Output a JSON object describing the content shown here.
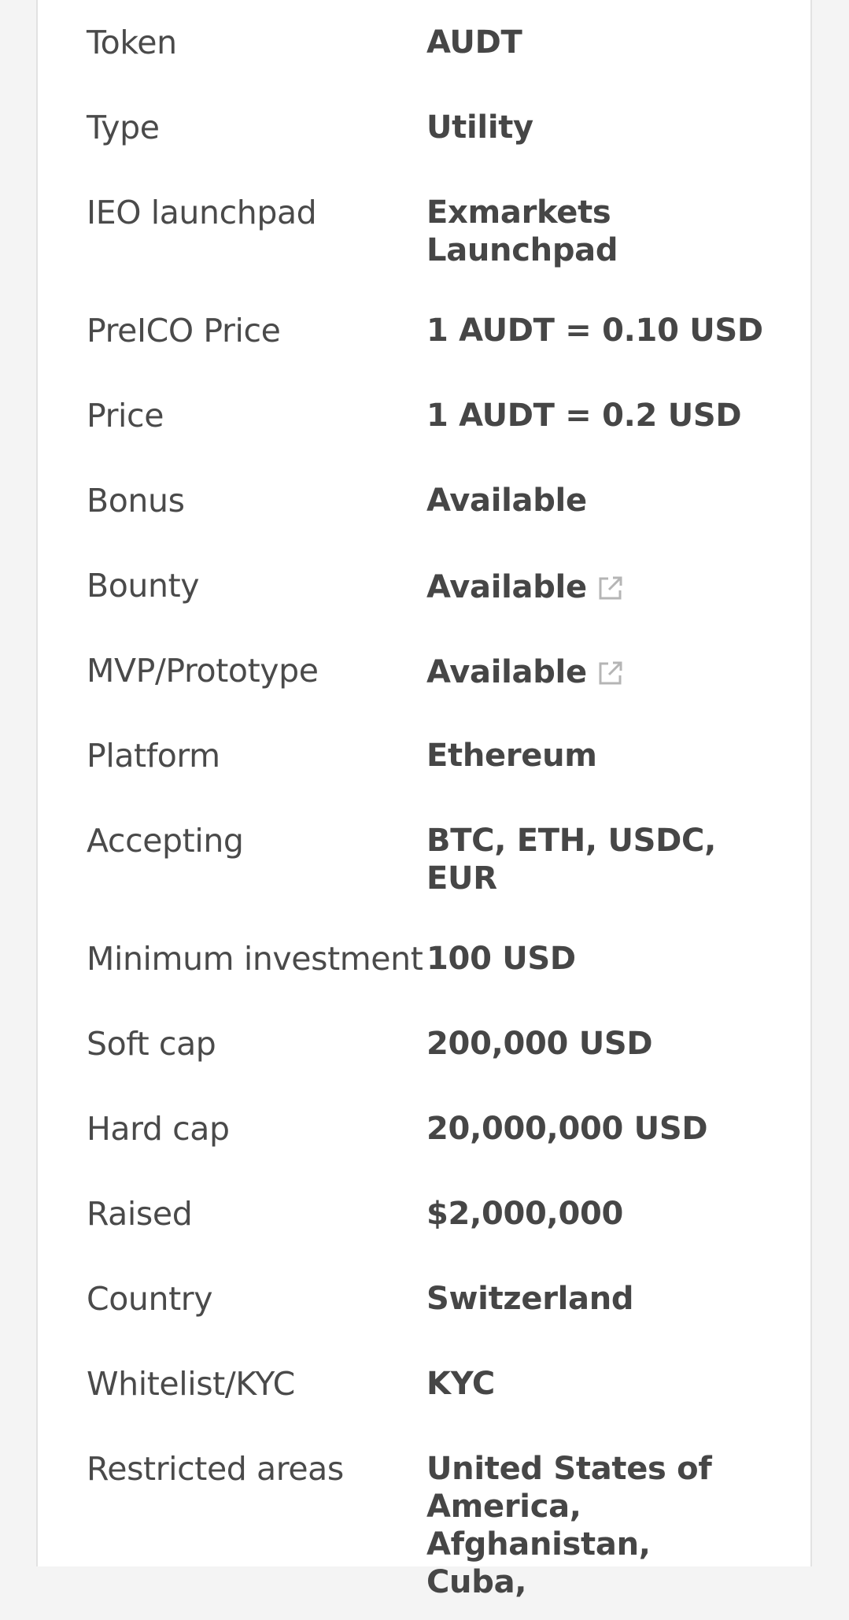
{
  "rows": [
    {
      "label": "Token",
      "value": "AUDT"
    },
    {
      "label": "Type",
      "value": "Utility"
    },
    {
      "label": "IEO launchpad",
      "value": "Exmarkets Launchpad"
    },
    {
      "label": "PreICO Price",
      "value": "1 AUDT = 0.10 USD"
    },
    {
      "label": "Price",
      "value": "1 AUDT = 0.2 USD"
    },
    {
      "label": "Bonus",
      "value": "Available"
    },
    {
      "label": "Bounty",
      "value": "Available",
      "icon": "external-link-icon"
    },
    {
      "label": "MVP/Prototype",
      "value": "Available",
      "icon": "external-link-icon"
    },
    {
      "label": "Platform",
      "value": "Ethereum"
    },
    {
      "label": "Accepting",
      "value": "BTC, ETH, USDC, EUR"
    },
    {
      "label": "Minimum investment",
      "value": "100 USD"
    },
    {
      "label": "Soft cap",
      "value": "200,000 USD"
    },
    {
      "label": "Hard cap",
      "value": "20,000,000 USD"
    },
    {
      "label": "Raised",
      "value": "$2,000,000"
    },
    {
      "label": "Country",
      "value": "Switzerland"
    },
    {
      "label": "Whitelist/KYC",
      "value": "KYC"
    },
    {
      "label": "Restricted areas",
      "value": "United States of America, Afghanistan, Cuba,"
    }
  ],
  "colors": {
    "label": "#4a4a4a",
    "value": "#464646",
    "icon": "#b5b5b5",
    "card_border": "#e2e2e2",
    "background": "#f4f4f4"
  }
}
